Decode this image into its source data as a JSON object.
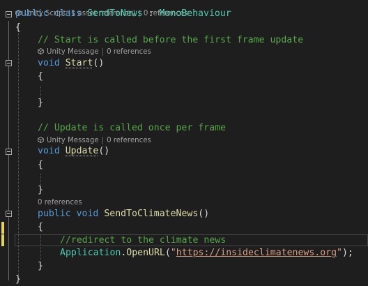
{
  "codelens": {
    "class_lens": "Unity Script (1 asset reference)",
    "class_refs": "0 references",
    "start_lens": "Unity Message",
    "start_refs": "0 references",
    "update_lens": "Unity Message",
    "update_refs": "0 references",
    "method_refs": "0 references"
  },
  "code": {
    "kw_public": "public",
    "kw_class": "class",
    "class_name": "SendToNews",
    "colon": " : ",
    "base_class": "MonoBehaviour",
    "brace_open": "{",
    "brace_close": "}",
    "comment_start": "// Start is called before the first frame update",
    "kw_void": "void",
    "start_name": "Start",
    "parens": "()",
    "comment_update": "// Update is called once per frame",
    "update_name": "Update",
    "method_name": "SendToClimateNews",
    "comment_redirect": "//redirect to the climate news",
    "app_class": "Application",
    "dot": ".",
    "open_url": "OpenURL",
    "paren_open": "(",
    "quote": "\"",
    "url": "https://insideclimatenews.org",
    "paren_close_semi": ");"
  },
  "colors": {
    "background": "#1e1e1e",
    "keyword": "#569cd6",
    "type": "#4ec9b0",
    "method": "#dcdcaa",
    "comment": "#57a64a",
    "string": "#d69d85",
    "change_marker": "#e6d25f"
  }
}
